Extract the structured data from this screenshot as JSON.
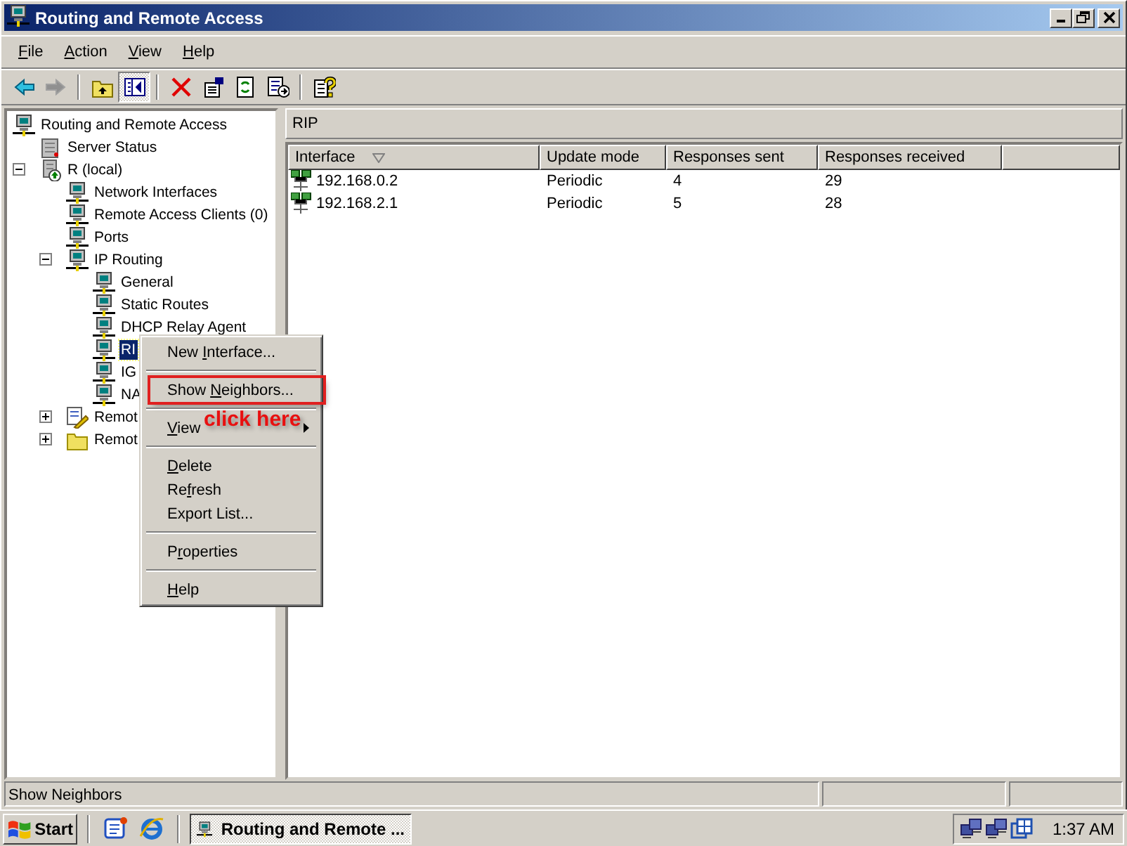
{
  "window": {
    "title": "Routing and Remote Access"
  },
  "menu_bar": [
    {
      "key": "F",
      "rest": "ile"
    },
    {
      "key": "A",
      "rest": "ction"
    },
    {
      "key": "V",
      "rest": "iew"
    },
    {
      "key": "H",
      "rest": "elp"
    }
  ],
  "toolbar": [
    [
      {
        "kind": "back",
        "disabled": false
      },
      {
        "kind": "forward",
        "disabled": true
      }
    ],
    [
      {
        "kind": "up-folder",
        "pressed": false
      },
      {
        "kind": "tree-toggle",
        "pressed": true
      }
    ],
    [
      {
        "kind": "delete",
        "pressed": false
      },
      {
        "kind": "properties",
        "pressed": false
      },
      {
        "kind": "refresh",
        "pressed": false
      },
      {
        "kind": "export",
        "pressed": false
      }
    ],
    [
      {
        "kind": "help",
        "pressed": false
      }
    ]
  ],
  "tree": [
    {
      "label": "Routing and Remote Access",
      "kind": "console",
      "selected": false,
      "children": [
        {
          "label": "Server Status",
          "kind": "server-status",
          "selected": false
        },
        {
          "label": "R (local)",
          "kind": "server",
          "selected": false,
          "expanded": true,
          "children": [
            {
              "label": "Network Interfaces",
              "kind": "network",
              "selected": false
            },
            {
              "label": "Remote Access Clients (0)",
              "kind": "network",
              "selected": false
            },
            {
              "label": "Ports",
              "kind": "network",
              "selected": false
            },
            {
              "label": "IP Routing",
              "kind": "network",
              "selected": false,
              "expanded": true,
              "children": [
                {
                  "label": "General",
                  "kind": "network",
                  "selected": false
                },
                {
                  "label": "Static Routes",
                  "kind": "network",
                  "selected": false
                },
                {
                  "label": "DHCP Relay Agent",
                  "kind": "network",
                  "selected": false
                },
                {
                  "label": "RI",
                  "kind": "network",
                  "selected": true
                },
                {
                  "label": "IG",
                  "kind": "network",
                  "selected": false
                },
                {
                  "label": "NA",
                  "kind": "network",
                  "selected": false
                }
              ]
            },
            {
              "label": "Remot",
              "kind": "policy",
              "selected": false,
              "expanded": false
            },
            {
              "label": "Remot",
              "kind": "folder",
              "selected": false,
              "expanded": false
            }
          ]
        }
      ]
    }
  ],
  "details": {
    "title": "RIP",
    "columns": [
      {
        "label": "Interface",
        "sorted": true
      },
      {
        "label": "Update mode",
        "sorted": false
      },
      {
        "label": "Responses sent",
        "sorted": false
      },
      {
        "label": "Responses received",
        "sorted": false
      }
    ],
    "rows": [
      {
        "interface": "192.168.0.2",
        "update_mode": "Periodic",
        "responses_sent": "4",
        "responses_received": "29"
      },
      {
        "interface": "192.168.2.1",
        "update_mode": "Periodic",
        "responses_sent": "5",
        "responses_received": "28"
      }
    ]
  },
  "context_menu": [
    {
      "kind": "item",
      "before": "New ",
      "key": "I",
      "after": "nterface...",
      "highlighted": false
    },
    {
      "kind": "separator"
    },
    {
      "kind": "item",
      "before": "Show ",
      "key": "N",
      "after": "eighbors...",
      "highlighted": true
    },
    {
      "kind": "separator"
    },
    {
      "kind": "submenu",
      "key": "V",
      "after": "iew",
      "highlighted": false
    },
    {
      "kind": "separator"
    },
    {
      "kind": "item",
      "key": "D",
      "after": "elete",
      "highlighted": false
    },
    {
      "kind": "item",
      "before": "Re",
      "key": "f",
      "after": "resh",
      "highlighted": false
    },
    {
      "kind": "item",
      "before": "Export List...",
      "highlighted": false
    },
    {
      "kind": "separator"
    },
    {
      "kind": "item",
      "before": "P",
      "key": "r",
      "after": "operties",
      "highlighted": false
    },
    {
      "kind": "separator"
    },
    {
      "kind": "item",
      "key": "H",
      "after": "elp",
      "highlighted": false
    }
  ],
  "annotation": {
    "text": "click here"
  },
  "status_bar": {
    "text": "Show Neighbors"
  },
  "taskbar": {
    "start": "Start",
    "quick_launch": [
      {
        "kind": "desktop"
      },
      {
        "kind": "browser"
      }
    ],
    "tasks": [
      {
        "label": "Routing and Remote ...",
        "selected": true
      }
    ],
    "tray": [
      {
        "kind": "network"
      },
      {
        "kind": "network"
      },
      {
        "kind": "windows"
      }
    ],
    "clock": "1:37 AM"
  }
}
